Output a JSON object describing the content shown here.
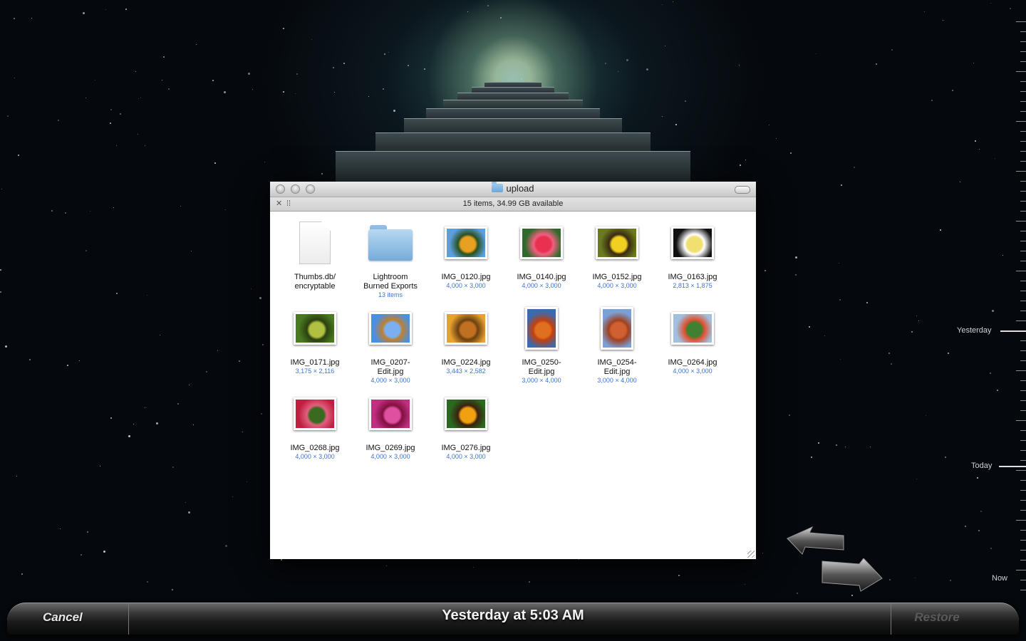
{
  "window": {
    "title": "upload",
    "status": "15 items, 34.99 GB available"
  },
  "items": [
    {
      "name": "Thumbs.db/\nencryptable",
      "meta": "",
      "kind": "doc"
    },
    {
      "name": "Lightroom\nBurned Exports",
      "meta": "13 items",
      "kind": "folder"
    },
    {
      "name": "IMG_0120.jpg",
      "meta": "4,000 × 3,000",
      "kind": "photo",
      "colors": [
        "#5aa0e0",
        "#e8a020",
        "#2a5020"
      ]
    },
    {
      "name": "IMG_0140.jpg",
      "meta": "4,000 × 3,000",
      "kind": "photo",
      "colors": [
        "#2f6a2a",
        "#e83050",
        "#f06080"
      ]
    },
    {
      "name": "IMG_0152.jpg",
      "meta": "4,000 × 3,000",
      "kind": "photo",
      "colors": [
        "#6a7a20",
        "#f0d020",
        "#3a2a10"
      ]
    },
    {
      "name": "IMG_0163.jpg",
      "meta": "2,813 × 1,875",
      "kind": "photo",
      "colors": [
        "#101010",
        "#f0e070",
        "#ffffff"
      ]
    },
    {
      "name": "IMG_0171.jpg",
      "meta": "3,175 × 2,116",
      "kind": "photo",
      "colors": [
        "#4a7a20",
        "#b0c040",
        "#2a4010"
      ]
    },
    {
      "name": "IMG_0207-\nEdit.jpg",
      "meta": "4,000 × 3,000",
      "kind": "photo",
      "colors": [
        "#4a90e0",
        "#7ab0f0",
        "#c08030"
      ]
    },
    {
      "name": "IMG_0224.jpg",
      "meta": "3,443 × 2,582",
      "kind": "photo",
      "colors": [
        "#e8a030",
        "#c07020",
        "#6a4010"
      ]
    },
    {
      "name": "IMG_0250-\nEdit.jpg",
      "meta": "3,000 × 4,000",
      "kind": "photo-portrait",
      "colors": [
        "#3a6ab0",
        "#e07020",
        "#c04010"
      ]
    },
    {
      "name": "IMG_0254-\nEdit.jpg",
      "meta": "3,000 × 4,000",
      "kind": "photo-portrait",
      "colors": [
        "#7aa0d8",
        "#d06030",
        "#a04020"
      ]
    },
    {
      "name": "IMG_0264.jpg",
      "meta": "4,000 × 3,000",
      "kind": "photo",
      "colors": [
        "#a0c0e0",
        "#408030",
        "#e05030"
      ]
    },
    {
      "name": "IMG_0268.jpg",
      "meta": "4,000 × 3,000",
      "kind": "photo",
      "colors": [
        "#c02040",
        "#3a6a20",
        "#e06080"
      ]
    },
    {
      "name": "IMG_0269.jpg",
      "meta": "4,000 × 3,000",
      "kind": "photo",
      "colors": [
        "#c03080",
        "#e050a0",
        "#801040"
      ]
    },
    {
      "name": "IMG_0276.jpg",
      "meta": "4,000 × 3,000",
      "kind": "photo",
      "colors": [
        "#2a6a20",
        "#f0a010",
        "#3a2010"
      ]
    }
  ],
  "timeline": {
    "labels": [
      "Yesterday",
      "Today",
      "Now"
    ]
  },
  "bottombar": {
    "cancel_label": "Cancel",
    "date_label": "Yesterday at 5:03 AM",
    "restore_label": "Restore"
  }
}
